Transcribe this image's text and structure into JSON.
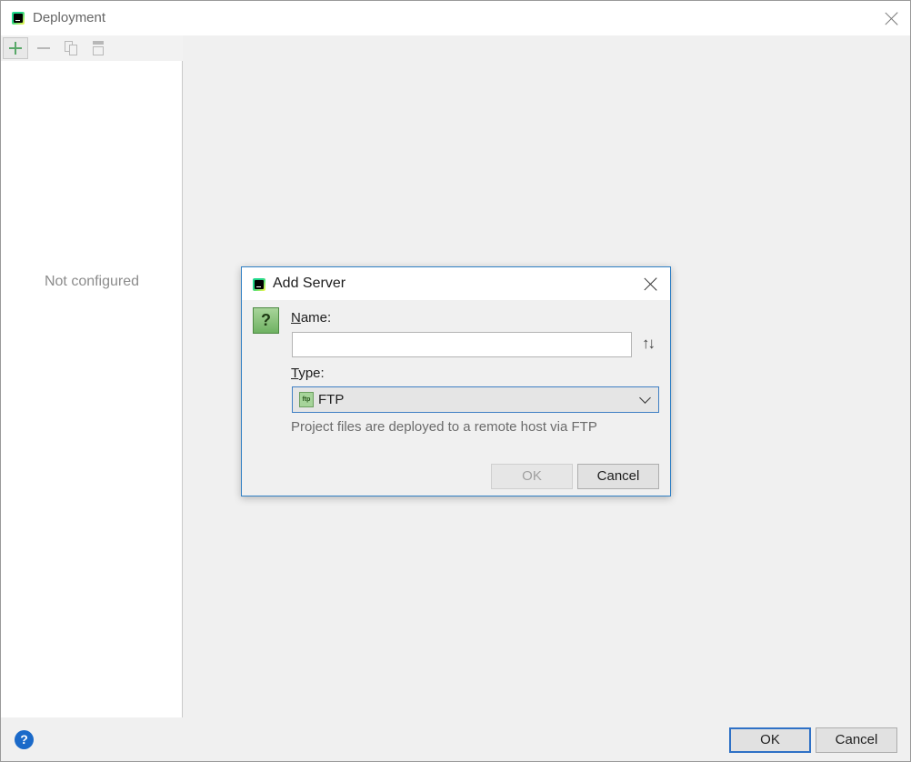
{
  "window": {
    "title": "Deployment"
  },
  "toolbar": {
    "add_icon": "plus-icon",
    "remove_icon": "minus-icon",
    "copy_icon": "copy-icon",
    "default_icon": "set-default-icon"
  },
  "sidebar": {
    "empty_text": "Not configured"
  },
  "footer": {
    "help_symbol": "?",
    "ok_label": "OK",
    "cancel_label": "Cancel"
  },
  "dialog": {
    "title": "Add Server",
    "question_symbol": "?",
    "name_label_mnemonic": "N",
    "name_label_rest": "ame:",
    "name_value": "",
    "sort_symbol": "↑↓",
    "type_label_mnemonic": "T",
    "type_label_rest": "ype:",
    "type_icon_text": "ftp",
    "type_value": "FTP",
    "description": "Project files are deployed to a remote host via FTP",
    "ok_label": "OK",
    "cancel_label": "Cancel"
  },
  "colors": {
    "accent": "#2f71c6",
    "add_green": "#59a869",
    "help_blue": "#1b6ac9"
  }
}
